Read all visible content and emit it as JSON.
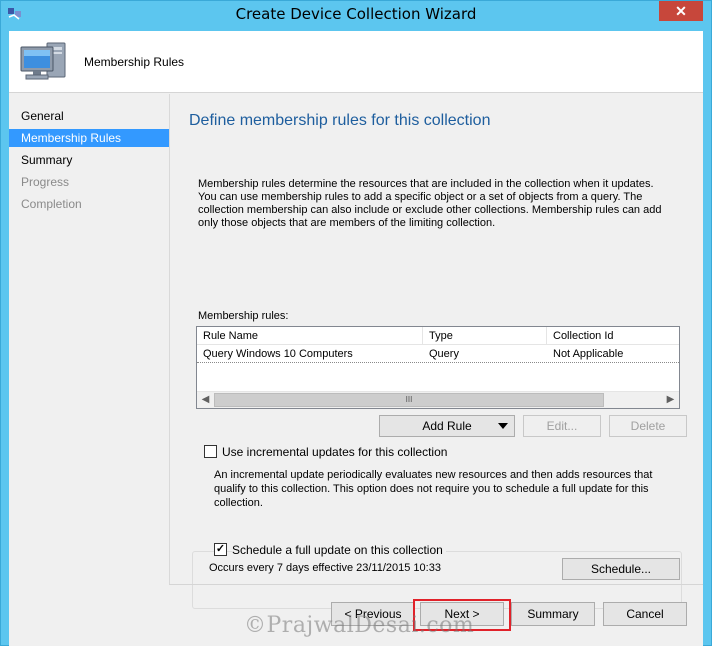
{
  "window": {
    "title": "Create Device Collection Wizard",
    "close_label": "✕"
  },
  "header": {
    "title": "Membership Rules",
    "icon": "computer-icon"
  },
  "nav": {
    "items": [
      {
        "label": "General",
        "state": "normal"
      },
      {
        "label": "Membership Rules",
        "state": "active"
      },
      {
        "label": "Summary",
        "state": "normal"
      },
      {
        "label": "Progress",
        "state": "disabled"
      },
      {
        "label": "Completion",
        "state": "disabled"
      }
    ]
  },
  "main": {
    "title": "Define membership rules for this collection",
    "description": "Membership rules determine the resources that are included in the collection when it updates. You can use membership rules to add a specific object or a set of objects from a query. The collection membership can also include or exclude other collections. Membership rules can add only those objects that are members of the limiting collection.",
    "rules_label": "Membership rules:",
    "columns": [
      "Rule Name",
      "Type",
      "Collection Id"
    ],
    "rows": [
      {
        "name": "Query Windows 10 Computers",
        "type": "Query",
        "collection_id": "Not Applicable"
      }
    ],
    "scrollbar_grip": "III",
    "add_rule_label": "Add Rule",
    "edit_label": "Edit...",
    "delete_label": "Delete",
    "incremental_label": "Use incremental updates for this collection",
    "incremental_checked": false,
    "incremental_description": "An incremental update periodically evaluates new resources and then adds resources that qualify to this collection. This option does not require you to schedule a full update for this collection.",
    "schedule_label": "Schedule a full update on this collection",
    "schedule_checked": true,
    "schedule_text": "Occurs every 7 days effective 23/11/2015 10:33",
    "schedule_button": "Schedule..."
  },
  "footer": {
    "previous_label": "< Previous",
    "next_label": "Next >",
    "summary_label": "Summary",
    "cancel_label": "Cancel"
  },
  "watermark": "©PrajwalDesai.com",
  "colors": {
    "titlebar": "#5cc6ef",
    "selected_nav": "#3399ff",
    "page_title": "#1e5e9e",
    "focus_highlight": "#e1222a",
    "close_button": "#c7473b"
  }
}
